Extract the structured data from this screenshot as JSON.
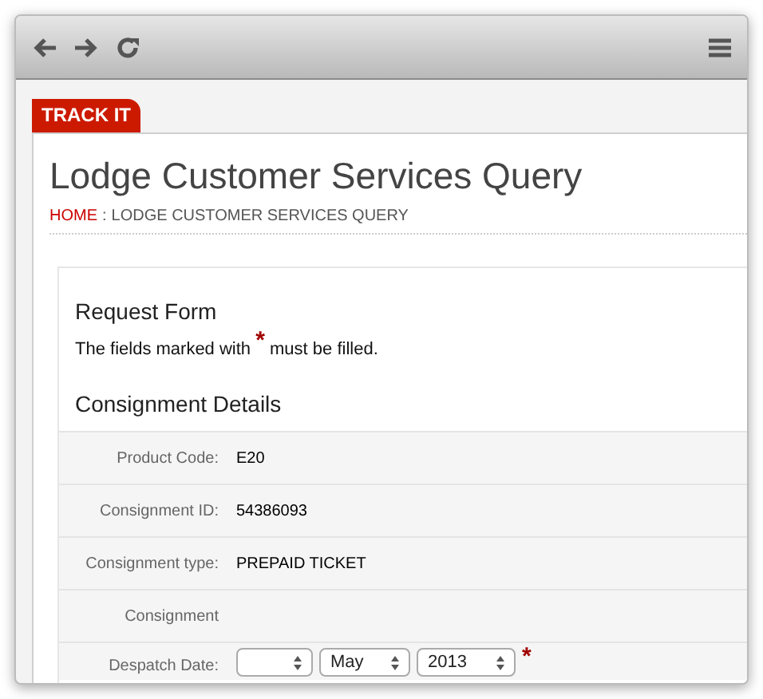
{
  "tab": {
    "label": "TRACK IT"
  },
  "page": {
    "title": "Lodge Customer Services Query",
    "breadcrumb": {
      "home": "HOME",
      "separator": ":",
      "current": "LODGE CUSTOMER SERVICES QUERY"
    }
  },
  "form": {
    "title": "Request Form",
    "note_before": "The fields marked with",
    "required_mark": "*",
    "note_after": "must be filled.",
    "section": "Consignment Details",
    "rows": [
      {
        "kind": "text",
        "label": "Product Code:",
        "value": "E20"
      },
      {
        "kind": "text",
        "label": "Consignment ID:",
        "value": "54386093"
      },
      {
        "kind": "text",
        "label": "Consignment type:",
        "value": "PREPAID TICKET"
      },
      {
        "kind": "text",
        "label": "Consignment"
      },
      {
        "kind": "date",
        "label": "Despatch Date:",
        "required": true,
        "selects": [
          {
            "kind": "blank"
          },
          {
            "kind": "filled",
            "value": "May"
          },
          {
            "kind": "filled",
            "value": "2013"
          }
        ]
      }
    ]
  }
}
